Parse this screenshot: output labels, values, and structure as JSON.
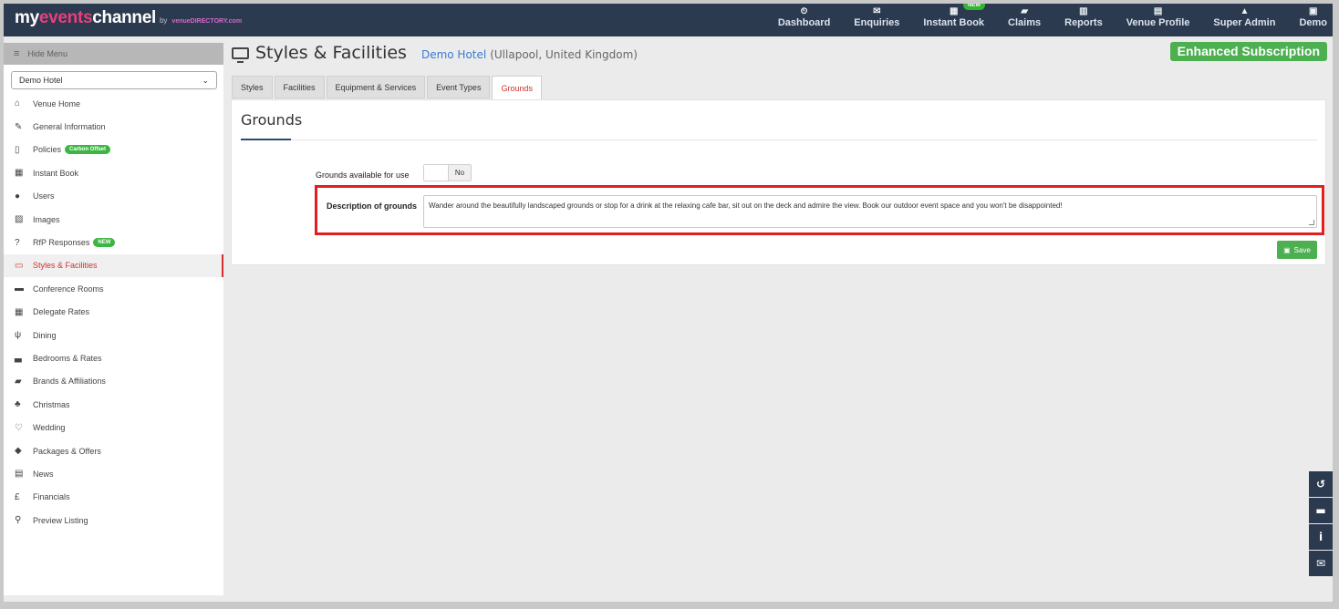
{
  "brand": {
    "part1": "my",
    "part2": "events",
    "part3": "channel",
    "by": "by",
    "brand_mark": "venueDIRECTORY.com"
  },
  "topnav": [
    {
      "icon": "dashboard-icon",
      "glyph": "⏲",
      "label": "Dashboard"
    },
    {
      "icon": "envelope-icon",
      "glyph": "✉",
      "label": "Enquiries"
    },
    {
      "icon": "calendar-icon",
      "glyph": "▦",
      "label": "Instant Book",
      "badge": "NEW"
    },
    {
      "icon": "book-icon",
      "glyph": "▰",
      "label": "Claims"
    },
    {
      "icon": "chart-icon",
      "glyph": "▥",
      "label": "Reports"
    },
    {
      "icon": "building-icon",
      "glyph": "▤",
      "label": "Venue Profile"
    },
    {
      "icon": "lock-icon",
      "glyph": "▲",
      "label": "Super Admin"
    },
    {
      "icon": "user-icon",
      "glyph": "▣",
      "label": "Demo"
    }
  ],
  "sidebar": {
    "hide_menu": "Hide Menu",
    "venue_select": "Demo Hotel",
    "items": [
      {
        "icon": "home-icon",
        "glyph": "⌂",
        "label": "Venue Home"
      },
      {
        "icon": "edit-icon",
        "glyph": "✎",
        "label": "General Information"
      },
      {
        "icon": "document-icon",
        "glyph": "▯",
        "label": "Policies",
        "badge": "Carbon Offset"
      },
      {
        "icon": "calendar-icon",
        "glyph": "▦",
        "label": "Instant Book"
      },
      {
        "icon": "user-icon",
        "glyph": "●",
        "label": "Users"
      },
      {
        "icon": "image-icon",
        "glyph": "▨",
        "label": "Images"
      },
      {
        "icon": "question-icon",
        "glyph": "?",
        "label": "RfP Responses",
        "badge": "NEW"
      },
      {
        "icon": "monitor-icon",
        "glyph": "▭",
        "label": "Styles & Facilities",
        "active": true
      },
      {
        "icon": "briefcase-icon",
        "glyph": "▬",
        "label": "Conference Rooms"
      },
      {
        "icon": "calculator-icon",
        "glyph": "▦",
        "label": "Delegate Rates"
      },
      {
        "icon": "cutlery-icon",
        "glyph": "ψ",
        "label": "Dining"
      },
      {
        "icon": "bed-icon",
        "glyph": "▃",
        "label": "Bedrooms & Rates"
      },
      {
        "icon": "book-icon",
        "glyph": "▰",
        "label": "Brands & Affiliations"
      },
      {
        "icon": "tree-icon",
        "glyph": "♣",
        "label": "Christmas"
      },
      {
        "icon": "heart-icon",
        "glyph": "♡",
        "label": "Wedding"
      },
      {
        "icon": "tags-icon",
        "glyph": "◆",
        "label": "Packages & Offers"
      },
      {
        "icon": "newspaper-icon",
        "glyph": "▤",
        "label": "News"
      },
      {
        "icon": "pound-icon",
        "glyph": "£",
        "label": "Financials"
      },
      {
        "icon": "search-icon",
        "glyph": "⚲",
        "label": "Preview Listing"
      }
    ]
  },
  "header": {
    "title": "Styles & Facilities",
    "hotel_name": "Demo Hotel",
    "hotel_location": "(Ullapool, United Kingdom)",
    "subscription": "Enhanced Subscription"
  },
  "tabs": [
    {
      "label": "Styles"
    },
    {
      "label": "Facilities"
    },
    {
      "label": "Equipment & Services"
    },
    {
      "label": "Event Types"
    },
    {
      "label": "Grounds",
      "active": true
    }
  ],
  "grounds": {
    "title": "Grounds",
    "available_label": "Grounds available for use",
    "available_value": "No",
    "description_label": "Description of grounds",
    "description_value": "Wander around the beautifully landscaped grounds or stop for a drink at the relaxing cafe bar, sit out on the deck and admire the view. Book our outdoor event space and you won't be disappointed!",
    "save_label": "Save"
  },
  "dock": [
    {
      "icon": "history-icon",
      "glyph": "↺"
    },
    {
      "icon": "chat-icon",
      "glyph": "▬"
    },
    {
      "icon": "info-icon",
      "glyph": "i"
    },
    {
      "icon": "mail-icon",
      "glyph": "✉"
    }
  ],
  "colors": {
    "topbar": "#2b3a4e",
    "accent_red": "#d32f2f",
    "green": "#4caf50",
    "link_blue": "#3a7bd5",
    "highlight": "#e02020"
  }
}
